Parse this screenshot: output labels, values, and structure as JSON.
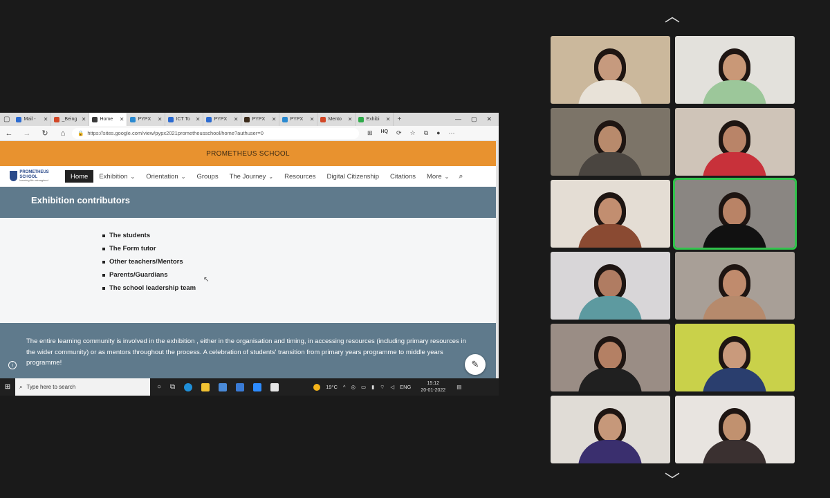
{
  "browser": {
    "tabs": [
      {
        "label": "Mail -",
        "color": "#2a6ad1"
      },
      {
        "label": "_Being",
        "color": "#d24726"
      },
      {
        "label": "Home",
        "color": "#3a3a3a",
        "active": true
      },
      {
        "label": "PYPX",
        "color": "#2a8ad1"
      },
      {
        "label": "ICT To",
        "color": "#2a6ad1"
      },
      {
        "label": "PYPX",
        "color": "#2a6ad1"
      },
      {
        "label": "PYPX",
        "color": "#3a2a1a"
      },
      {
        "label": "PYPX",
        "color": "#2a8ad1"
      },
      {
        "label": "Mento",
        "color": "#d24726"
      },
      {
        "label": "Exhibi",
        "color": "#2faa4a"
      }
    ],
    "new_tab": "+",
    "url": "https://sites.google.com/view/pypx2021prometheusschool/home?authuser=0",
    "hq_label": "HQ"
  },
  "site": {
    "banner": "PROMETHEUS SCHOOL",
    "logo_name": "PROMETHEUS SCHOOL",
    "logo_tagline": "learning life reimagined",
    "nav": [
      {
        "label": "Home",
        "current": true,
        "dropdown": false
      },
      {
        "label": "Exhibition",
        "dropdown": true
      },
      {
        "label": "Orientation",
        "dropdown": true
      },
      {
        "label": "Groups",
        "dropdown": false
      },
      {
        "label": "The Journey",
        "dropdown": true
      },
      {
        "label": "Resources",
        "dropdown": false
      },
      {
        "label": "Digital Citizenship",
        "dropdown": false
      },
      {
        "label": "Citations",
        "dropdown": false
      },
      {
        "label": "More",
        "dropdown": true
      }
    ],
    "section_title": "Exhibition contributors",
    "contributors": [
      "The students",
      "The Form tutor",
      "Other teachers/Mentors",
      "Parents/Guardians",
      "The school leadership team"
    ],
    "footer_text": "The entire learning community is involved in the exhibition , either in the organisation and timing, in accessing resources (including primary resources in the wider community) or as mentors throughout the process. A celebration of students' transition from primary years programme to middle years programme!"
  },
  "taskbar": {
    "search_placeholder": "Type here to search",
    "weather": "19°C",
    "language": "ENG",
    "time": "15:12",
    "date": "20-01-2022"
  },
  "gallery": {
    "tile_count": 12,
    "active_speaker_index": 5,
    "participants": [
      {
        "bg": "#cbb89c",
        "skin": "#c69a7e",
        "shirt": "#e8e2d8"
      },
      {
        "bg": "#e3e1dc",
        "skin": "#c99877",
        "shirt": "#9cc79a"
      },
      {
        "bg": "#7c7468",
        "skin": "#b88a6c",
        "shirt": "#4a4540"
      },
      {
        "bg": "#cfc4b8",
        "skin": "#b98468",
        "shirt": "#c8313a"
      },
      {
        "bg": "#e4ddd4",
        "skin": "#c28e70",
        "shirt": "#8a4a32"
      },
      {
        "bg": "#8a8682",
        "skin": "#b98366",
        "shirt": "#111111"
      },
      {
        "bg": "#d8d6d8",
        "skin": "#b07c62",
        "shirt": "#5d9aa0"
      },
      {
        "bg": "#a89f97",
        "skin": "#c08b6d",
        "shirt": "#b68a6c"
      },
      {
        "bg": "#9a8d85",
        "skin": "#b48064",
        "shirt": "#202020"
      },
      {
        "bg": "#c9d14a",
        "skin": "#c99a7c",
        "shirt": "#2a3e6e"
      },
      {
        "bg": "#e0dcd6",
        "skin": "#c6987a",
        "shirt": "#3a2f6e"
      },
      {
        "bg": "#e8e4e0",
        "skin": "#c1916f",
        "shirt": "#3a3030"
      }
    ]
  }
}
